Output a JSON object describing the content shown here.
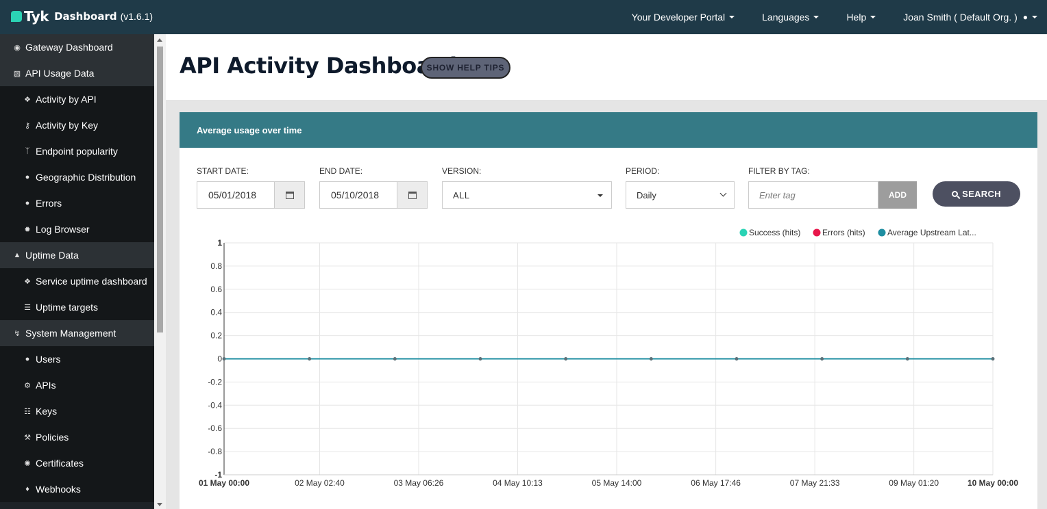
{
  "app": {
    "brand": "Tyk",
    "product": "Dashboard",
    "version": "(v1.6.1)"
  },
  "topnav": {
    "portal": "Your Developer Portal",
    "languages": "Languages",
    "help": "Help",
    "user": "Joan Smith ( Default Org. )"
  },
  "sidebar": {
    "items": [
      {
        "label": "Gateway Dashboard",
        "icon": "dashboard-icon"
      },
      {
        "label": "API Usage Data",
        "icon": "bar-chart-icon"
      },
      {
        "label": "Activity by API",
        "icon": "cubes-icon"
      },
      {
        "label": "Activity by Key",
        "icon": "key-icon"
      },
      {
        "label": "Endpoint popularity",
        "icon": "branch-icon"
      },
      {
        "label": "Geographic Distribution",
        "icon": "globe-icon"
      },
      {
        "label": "Errors",
        "icon": "bomb-icon"
      },
      {
        "label": "Log Browser",
        "icon": "bug-icon"
      },
      {
        "label": "Uptime Data",
        "icon": "arrow-up-circle-icon"
      },
      {
        "label": "Service uptime dashboard",
        "icon": "cubes-icon"
      },
      {
        "label": "Uptime targets",
        "icon": "list-icon"
      },
      {
        "label": "System Management",
        "icon": "bolt-icon"
      },
      {
        "label": "Users",
        "icon": "user-icon"
      },
      {
        "label": "APIs",
        "icon": "gears-icon"
      },
      {
        "label": "Keys",
        "icon": "sitemap-icon"
      },
      {
        "label": "Policies",
        "icon": "gavel-icon"
      },
      {
        "label": "Certificates",
        "icon": "certificate-icon"
      },
      {
        "label": "Webhooks",
        "icon": "bell-icon"
      }
    ]
  },
  "page": {
    "title": "API Activity Dashboard",
    "help_button": "SHOW HELP TIPS"
  },
  "panel": {
    "title": "Average usage over time"
  },
  "filters": {
    "start_label": "START DATE:",
    "start_value": "05/01/2018",
    "end_label": "END DATE:",
    "end_value": "05/10/2018",
    "version_label": "VERSION:",
    "version_value": "ALL",
    "period_label": "PERIOD:",
    "period_value": "Daily",
    "tag_label": "FILTER BY TAG:",
    "tag_placeholder": "Enter tag",
    "add_button": "ADD",
    "search_button": "SEARCH"
  },
  "chart_data": {
    "type": "line",
    "x": [
      "01 May 00:00",
      "02 May 02:40",
      "03 May 06:26",
      "04 May 10:13",
      "05 May 14:00",
      "06 May 17:46",
      "07 May 21:33",
      "09 May 01:20",
      "10 May 00:00"
    ],
    "series": [
      {
        "name": "Success (hits)",
        "color": "#2ad3b5",
        "values": [
          0,
          0,
          0,
          0,
          0,
          0,
          0,
          0,
          0,
          0
        ]
      },
      {
        "name": "Errors (hits)",
        "color": "#e8174b",
        "values": [
          0,
          0,
          0,
          0,
          0,
          0,
          0,
          0,
          0,
          0
        ]
      },
      {
        "name": "Average Upstream Lat...",
        "color": "#1e8ea1",
        "values": [
          0,
          0,
          0,
          0,
          0,
          0,
          0,
          0,
          0,
          0
        ]
      }
    ],
    "yticks": [
      "1",
      "0.8",
      "0.6",
      "0.4",
      "0.2",
      "0",
      "-0.2",
      "-0.4",
      "-0.6",
      "-0.8",
      "-1"
    ],
    "ylim": [
      -1,
      1
    ],
    "legend": "top-right",
    "grid": true
  }
}
